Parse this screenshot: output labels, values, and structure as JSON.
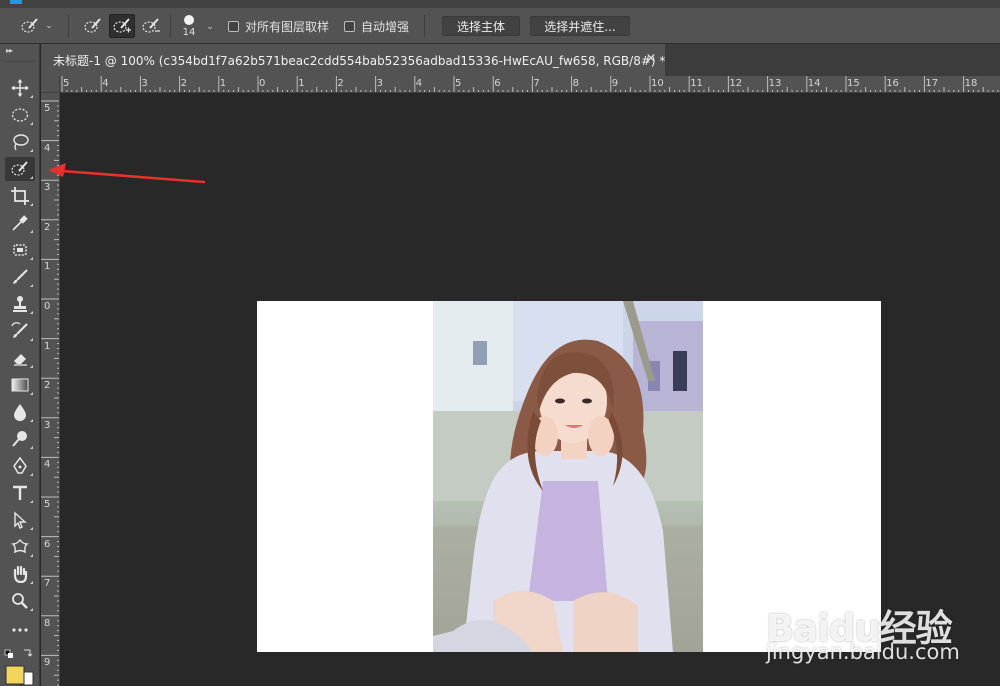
{
  "options_bar": {
    "brush_size": "14",
    "sample_all_layers_label": "对所有图层取样",
    "auto_enhance_label": "自动增强",
    "select_subject_label": "选择主体",
    "select_and_mask_label": "选择并遮住..."
  },
  "document": {
    "tab_title": "未标题-1 @ 100% (c354bd1f7a62b571beac2cdd554bab52356adbad15336-HwEcAU_fw658, RGB/8#) *",
    "close_glyph": "×"
  },
  "rulers": {
    "horizontal": [
      "5",
      "4",
      "3",
      "2",
      "1",
      "0",
      "1",
      "2",
      "3",
      "4",
      "5",
      "6",
      "7",
      "8",
      "9",
      "10",
      "11",
      "12",
      "13",
      "14",
      "15",
      "16",
      "17",
      "18"
    ],
    "vertical": [
      "5",
      "4",
      "3",
      "2",
      "1",
      "0",
      "1",
      "2",
      "3",
      "4",
      "5",
      "6",
      "7",
      "8",
      "9"
    ]
  },
  "tools": [
    {
      "name": "move-tool",
      "icon": "move-icon"
    },
    {
      "name": "marquee-tool",
      "icon": "elliptical-marquee-icon"
    },
    {
      "name": "lasso-tool",
      "icon": "lasso-icon"
    },
    {
      "name": "quick-selection-tool",
      "icon": "quick-selection-icon",
      "active": true
    },
    {
      "name": "crop-tool",
      "icon": "crop-icon"
    },
    {
      "name": "eyedropper-tool",
      "icon": "eyedropper-icon"
    },
    {
      "name": "healing-brush-tool",
      "icon": "healing-brush-icon"
    },
    {
      "name": "brush-tool",
      "icon": "brush-icon"
    },
    {
      "name": "clone-stamp-tool",
      "icon": "stamp-icon"
    },
    {
      "name": "history-brush-tool",
      "icon": "history-brush-icon"
    },
    {
      "name": "eraser-tool",
      "icon": "eraser-icon"
    },
    {
      "name": "gradient-tool",
      "icon": "gradient-icon"
    },
    {
      "name": "blur-tool",
      "icon": "blur-drop-icon"
    },
    {
      "name": "dodge-tool",
      "icon": "dodge-icon"
    },
    {
      "name": "pen-tool",
      "icon": "pen-icon"
    },
    {
      "name": "type-tool",
      "icon": "type-icon"
    },
    {
      "name": "path-selection-tool",
      "icon": "path-selection-icon"
    },
    {
      "name": "custom-shape-tool",
      "icon": "custom-shape-icon"
    },
    {
      "name": "hand-tool",
      "icon": "hand-icon"
    },
    {
      "name": "zoom-tool",
      "icon": "zoom-icon"
    },
    {
      "name": "edit-toolbar",
      "icon": "more-icon"
    }
  ],
  "colors": {
    "ui_panel": "#535353",
    "workspace": "#282828",
    "foreground": "#f2d55e",
    "background": "#ffffff",
    "arrow": "#e5322d"
  },
  "watermark": {
    "brand": "Baidu经验",
    "url": "jingyan.baidu.com"
  }
}
